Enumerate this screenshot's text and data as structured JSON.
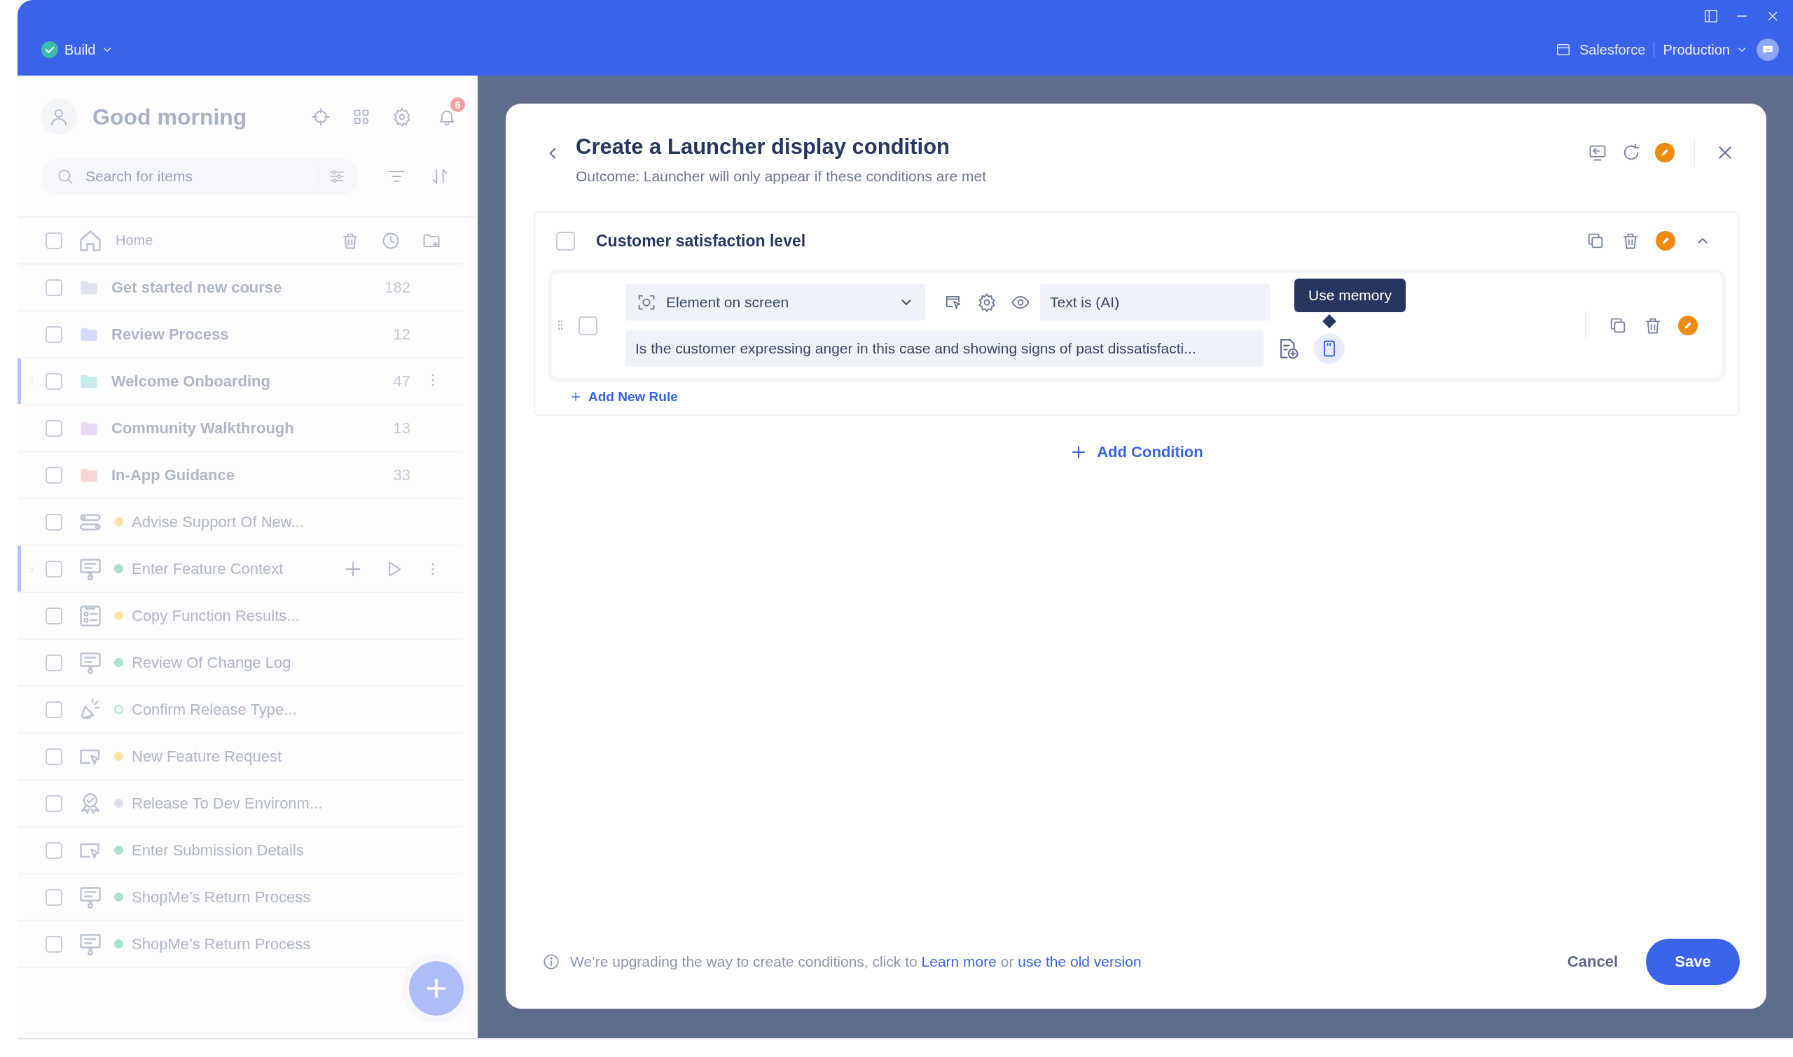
{
  "top_bar": {
    "status": "Build",
    "platform": "Salesforce",
    "environment": "Production"
  },
  "sidebar": {
    "greeting": "Good morning",
    "notification_count": "6",
    "search": {
      "placeholder": "Search for items"
    },
    "home": {
      "label": "Home",
      "checked": false
    },
    "items": [
      {
        "kind": "folder",
        "label": "Get started new course",
        "count": "182",
        "color": "#dfe2ea",
        "checked": false,
        "highlighted": false
      },
      {
        "kind": "folder",
        "label": "Review Process",
        "count": "12",
        "color": "#d6dcf8",
        "checked": false,
        "highlighted": false
      },
      {
        "kind": "folder",
        "label": "Welcome Onboarding",
        "count": "47",
        "color": "#c7ecee",
        "checked": false,
        "highlighted": true
      },
      {
        "kind": "folder",
        "label": "Community Walkthrough",
        "count": "13",
        "color": "#ead8f6",
        "checked": false,
        "highlighted": false
      },
      {
        "kind": "folder",
        "label": "In-App Guidance",
        "count": "33",
        "color": "#f6d6d6",
        "checked": false,
        "highlighted": false
      },
      {
        "kind": "flow",
        "label": "Advise Support Of New...",
        "color": "#fbe3a6",
        "hollow": false,
        "checked": false,
        "highlighted": false
      },
      {
        "kind": "tip",
        "label": "Enter Feature Context",
        "color": "#a9e0d3",
        "hollow": false,
        "checked": false,
        "highlighted": true
      },
      {
        "kind": "checklist",
        "label": "Copy Function Results...",
        "color": "#fbe3a6",
        "hollow": false,
        "checked": false,
        "highlighted": false
      },
      {
        "kind": "tip",
        "label": "Review Of Change Log",
        "color": "#a9e0d3",
        "hollow": false,
        "checked": false,
        "highlighted": false
      },
      {
        "kind": "megaphone",
        "label": "Confirm Release Type...",
        "color": "#a9e0d3",
        "hollow": true,
        "checked": false,
        "highlighted": false
      },
      {
        "kind": "pointer",
        "label": "New Feature Request",
        "color": "#fbe3a6",
        "hollow": false,
        "checked": false,
        "highlighted": false
      },
      {
        "kind": "badge",
        "label": "Release To Dev Environm...",
        "color": "#dcdfe6",
        "hollow": false,
        "checked": false,
        "highlighted": false
      },
      {
        "kind": "pointer",
        "label": "Enter Submission Details",
        "color": "#a9e0d3",
        "hollow": false,
        "checked": false,
        "highlighted": false
      },
      {
        "kind": "tip",
        "label": "ShopMe’s Return Process",
        "color": "#a9e0d3",
        "hollow": false,
        "checked": false,
        "highlighted": false
      },
      {
        "kind": "tip",
        "label": "ShopMe’s Return Process",
        "color": "#a9e0d3",
        "hollow": false,
        "checked": false,
        "highlighted": false
      }
    ]
  },
  "modal": {
    "title": "Create a Launcher display condition",
    "subtitle": "Outcome: Launcher will only appear if these conditions are met",
    "condition": {
      "title": "Customer satisfaction level",
      "checked": false,
      "expanded": true,
      "rules": [
        {
          "checked": false,
          "type": "Element on screen",
          "operator": "Text is (AI)",
          "value": "Is the customer expressing anger in this case and showing signs of past dissatisfacti...",
          "tooltip": "Use memory"
        }
      ],
      "add_rule": "Add New Rule"
    },
    "add_condition": "Add Condition",
    "notice": {
      "text": "We’re upgrading the way to create conditions, click to",
      "link": "Learn more",
      "joiner": "or",
      "link_2": "use the old version"
    },
    "cancel": "Cancel",
    "save": "Save"
  }
}
